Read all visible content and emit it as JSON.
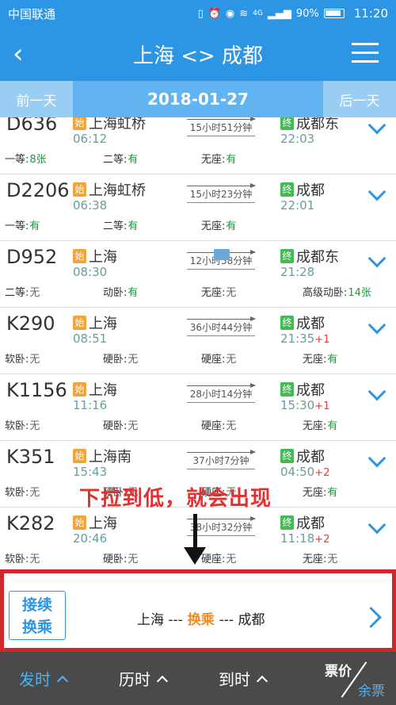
{
  "status_bar": {
    "carrier": "中国联通",
    "battery": "90%",
    "time": "11:20",
    "network": "4G"
  },
  "header": {
    "title": "上海 <> 成都"
  },
  "date_bar": {
    "prev_label": "前一天",
    "date": "2018-01-27",
    "next_label": "后一天"
  },
  "trains": [
    {
      "no": "D636",
      "dep_badge": "始",
      "dep_station": "上海虹桥",
      "dep_time": "06:12",
      "duration": "15小时51分钟",
      "arr_badge": "终",
      "arr_station": "成都东",
      "arr_time": "22:03",
      "day_offset": "",
      "seats": [
        {
          "name": "一等:",
          "value": "8张"
        },
        {
          "name": "二等:",
          "value": "有"
        },
        {
          "name": "无座:",
          "value": "有"
        }
      ]
    },
    {
      "no": "D2206",
      "dep_badge": "始",
      "dep_station": "上海虹桥",
      "dep_time": "06:38",
      "duration": "15小时23分钟",
      "arr_badge": "终",
      "arr_station": "成都",
      "arr_time": "22:01",
      "day_offset": "",
      "seats": [
        {
          "name": "一等:",
          "value": "有"
        },
        {
          "name": "二等:",
          "value": "有"
        },
        {
          "name": "无座:",
          "value": "有"
        }
      ]
    },
    {
      "no": "D952",
      "dep_badge": "始",
      "dep_station": "上海",
      "dep_time": "08:30",
      "duration": "12小时58分钟",
      "arr_badge": "终",
      "arr_station": "成都东",
      "arr_time": "21:28",
      "day_offset": "",
      "seats": [
        {
          "name": "二等:",
          "value": "无"
        },
        {
          "name": "动卧:",
          "value": "有"
        },
        {
          "name": "无座:",
          "value": "无"
        },
        {
          "name": "高级动卧:",
          "value": "14张"
        }
      ]
    },
    {
      "no": "K290",
      "dep_badge": "始",
      "dep_station": "上海",
      "dep_time": "08:51",
      "duration": "36小时44分钟",
      "arr_badge": "终",
      "arr_station": "成都",
      "arr_time": "21:35",
      "day_offset": "+1",
      "seats": [
        {
          "name": "软卧:",
          "value": "无"
        },
        {
          "name": "硬卧:",
          "value": "无"
        },
        {
          "name": "硬座:",
          "value": "无"
        },
        {
          "name": "无座:",
          "value": "有"
        }
      ]
    },
    {
      "no": "K1156",
      "dep_badge": "始",
      "dep_station": "上海",
      "dep_time": "11:16",
      "duration": "28小时14分钟",
      "arr_badge": "终",
      "arr_station": "成都",
      "arr_time": "15:30",
      "day_offset": "+1",
      "seats": [
        {
          "name": "软卧:",
          "value": "无"
        },
        {
          "name": "硬卧:",
          "value": "无"
        },
        {
          "name": "硬座:",
          "value": "无"
        },
        {
          "name": "无座:",
          "value": "有"
        }
      ]
    },
    {
      "no": "K351",
      "dep_badge": "始",
      "dep_station": "上海南",
      "dep_time": "15:43",
      "duration": "37小时7分钟",
      "arr_badge": "终",
      "arr_station": "成都",
      "arr_time": "04:50",
      "day_offset": "+2",
      "seats": [
        {
          "name": "软卧:",
          "value": "无"
        },
        {
          "name": "硬卧:",
          "value": "无"
        },
        {
          "name": "硬座:",
          "value": "无"
        },
        {
          "name": "无座:",
          "value": "有"
        }
      ]
    },
    {
      "no": "K282",
      "dep_badge": "始",
      "dep_station": "上海",
      "dep_time": "20:46",
      "duration": "38小时32分钟",
      "arr_badge": "终",
      "arr_station": "成都",
      "arr_time": "11:18",
      "day_offset": "+2",
      "seats": [
        {
          "name": "软卧:",
          "value": "无"
        },
        {
          "name": "硬卧:",
          "value": "无"
        },
        {
          "name": "硬座:",
          "value": "无"
        },
        {
          "name": "无座:",
          "value": "无"
        }
      ]
    }
  ],
  "annotation": {
    "text": "下拉到低，就会出现"
  },
  "transfer": {
    "tag_line1": "接续",
    "tag_line2": "换乘",
    "route_from": "上海 ---",
    "route_mid": " 换乘 ",
    "route_to": "--- 成都"
  },
  "bottom_bar": {
    "sort_depart": "发时",
    "sort_duration": "历时",
    "sort_arrive": "到时",
    "price_label": "票价",
    "remaining_label": "余票"
  },
  "colors": {
    "primary": "#2c95e4",
    "available": "#1a9a3a",
    "annotation": "#e53030",
    "transfer_accent": "#f08a1c"
  }
}
